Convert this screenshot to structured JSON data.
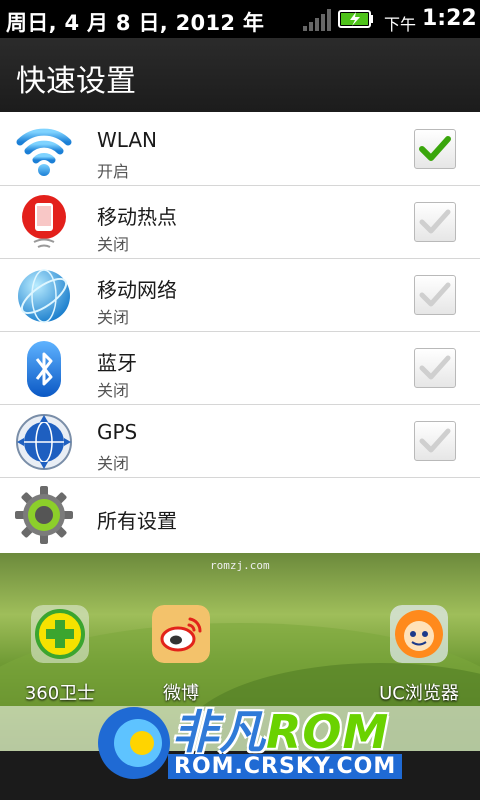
{
  "status_bar": {
    "date": "周日, 4 月 8 日, 2012 年",
    "ampm": "下午",
    "time": "1:22"
  },
  "panel": {
    "title": "快速设置",
    "items": [
      {
        "name": "WLAN",
        "status": "开启",
        "checked": true,
        "icon": "wifi-icon"
      },
      {
        "name": "移动热点",
        "status": "关闭",
        "checked": false,
        "icon": "mobile-hotspot-icon"
      },
      {
        "name": "移动网络",
        "status": "关闭",
        "checked": false,
        "icon": "mobile-network-icon"
      },
      {
        "name": "蓝牙",
        "status": "关闭",
        "checked": false,
        "icon": "bluetooth-icon"
      },
      {
        "name": "GPS",
        "status": "关闭",
        "checked": false,
        "icon": "gps-icon"
      }
    ],
    "all_settings": "所有设置"
  },
  "home": {
    "watermark": "romzj.com",
    "apps": [
      {
        "label": "360卫士",
        "icon": "360-security-icon"
      },
      {
        "label": "微博",
        "icon": "weibo-icon"
      },
      {
        "label": "UC浏览器",
        "icon": "uc-browser-icon"
      }
    ]
  },
  "overlay": {
    "brand_prefix": "非凡",
    "brand_suffix": "ROM",
    "url": "ROM.CRSKY.COM"
  },
  "colors": {
    "accent_check": "#3aa60c",
    "header_bg": "#1f1f1f",
    "brand_blue": "#2f7ad8",
    "brand_green": "#6ad200"
  }
}
